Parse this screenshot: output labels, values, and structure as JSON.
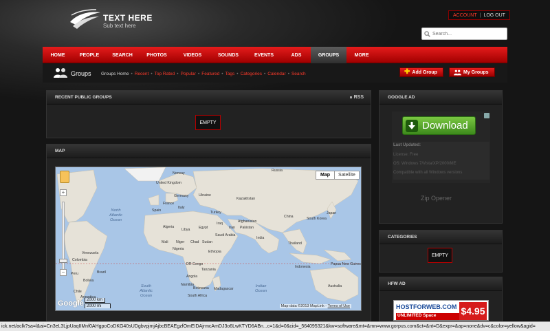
{
  "brand": {
    "title": "TEXT HERE",
    "subtitle": "Sub text here"
  },
  "account": {
    "account_label": "ACCOUNT",
    "separator": "|",
    "logout_label": "LOG OUT"
  },
  "search": {
    "placeholder": "Search..."
  },
  "nav": {
    "items": [
      "HOME",
      "PEOPLE",
      "SEARCH",
      "PHOTOS",
      "VIDEOS",
      "SOUNDS",
      "EVENTS",
      "ADS",
      "GROUPS",
      "MORE"
    ],
    "active": "GROUPS"
  },
  "groups": {
    "title": "Groups",
    "subnav": {
      "home": "Groups Home",
      "links": [
        "Recent",
        "Top Rated",
        "Popular",
        "Featured",
        "Tags",
        "Categories",
        "Calendar",
        "Search"
      ],
      "sep": "•"
    },
    "add_group": "Add Group",
    "my_groups": "My Groups"
  },
  "recent_groups": {
    "title": "RECENT PUBLIC GROUPS",
    "rss": "RSS",
    "empty": "EMPTY"
  },
  "map_panel": {
    "title": "MAP",
    "type_map": "Map",
    "type_satellite": "Satellite",
    "zoom_in": "+",
    "zoom_out": "−",
    "google": "Google",
    "scale_km": "2000 km",
    "scale_mi": "2000 mi",
    "attribution": "Map data ©2013 MapLink -",
    "terms": "Terms of Use",
    "labels": {
      "norway": "Norway",
      "russia": "Russia",
      "uk": "United Kingdom",
      "germany": "Germany",
      "ukraine": "Ukraine",
      "kazakhstan": "Kazakhstan",
      "france": "France",
      "spain": "Spain",
      "italy": "Italy",
      "turkey": "Turkey",
      "china": "China",
      "afghanistan": "Afghanistan",
      "iran": "Iran",
      "iraq": "Iraq",
      "pakistan": "Pakistan",
      "india": "India",
      "japan": "Japan",
      "south_korea": "South Korea",
      "algeria": "Algeria",
      "libya": "Libya",
      "egypt": "Egypt",
      "saudi": "Saudi Arabia",
      "mali": "Mali",
      "niger": "Niger",
      "chad": "Chad",
      "sudan": "Sudan",
      "nigeria": "Nigeria",
      "ethiopia": "Ethiopia",
      "drc": "DR Congo",
      "tanzania": "Tanzania",
      "angola": "Angola",
      "namibia": "Namibia",
      "botswana": "Botswana",
      "south_africa": "South Africa",
      "madagascar": "Madagascar",
      "thailand": "Thailand",
      "indonesia": "Indonesia",
      "papua": "Papua New Guinea",
      "australia": "Australia",
      "venezuela": "Venezuela",
      "colombia": "Colombia",
      "peru": "Peru",
      "brazil": "Brazil",
      "bolivia": "Bolivia",
      "chile": "Chile",
      "argentina": "Argentina",
      "north_atlantic": "North\nAtlantic\nOcean",
      "south_atlantic": "South\nAtlantic\nOcean",
      "indian_ocean": "Indian\nOcean"
    }
  },
  "google_ad": {
    "title": "GOOGLE AD",
    "download": "Download",
    "last_updated": "Last Updated:",
    "license": "License: Free",
    "os": "OS: Windows 7/Vista/XP/2000/ME",
    "line4": "Compatible with all Windows versions",
    "product": "Zip Opener"
  },
  "categories": {
    "title": "CATEGORIES",
    "empty": "EMPTY"
  },
  "hfw_ad": {
    "title": "HFW AD",
    "name": "HOSTFORWEB.COM",
    "unlimited": "UNLIMITED Space",
    "price": "$4.95"
  },
  "statusbar": {
    "url": "ick.net/aclk?sa=l&ai=Cn3eL3LjpUaqIIMnf0AHgpoCoDKG40sUDgbvpjmjAjbcBEAEgzfOmEIDAjrmcAmDJ3o6LwKTYD6ABn...c=1&d=0&cid=_564095321&kw=software&mt=&mn=www.gorpus.com&ct=&nt=D&expr=&ap=none&dv=c&color=yellow&agid="
  },
  "colors": {
    "accent": "#d40000",
    "link": "#ff3a2a",
    "ocean": "#a9c6e7",
    "land": "#e6e2d8",
    "download_green": "#5fae30"
  }
}
